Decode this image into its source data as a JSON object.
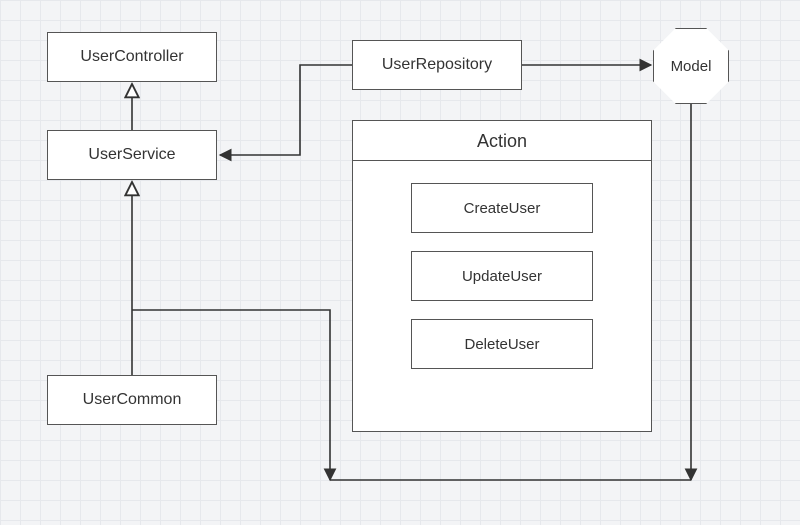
{
  "nodes": {
    "userController": "UserController",
    "userService": "UserService",
    "userCommon": "UserCommon",
    "userRepository": "UserRepository",
    "model": "Model",
    "actionTitle": "Action",
    "actions": {
      "createUser": "CreateUser",
      "updateUser": "UpdateUser",
      "deleteUser": "DeleteUser"
    }
  },
  "edges": [
    {
      "from": "UserService",
      "to": "UserController",
      "type": "open-arrow"
    },
    {
      "from": "UserCommon",
      "to": "UserService",
      "type": "open-arrow"
    },
    {
      "from": "UserRepository",
      "to": "UserService",
      "type": "filled-arrow"
    },
    {
      "from": "UserRepository",
      "to": "Model",
      "type": "filled-arrow"
    },
    {
      "from": "UserCommon",
      "to": "Action(bottom)",
      "type": "line-down"
    },
    {
      "from": "Model",
      "to": "Action(bottom)",
      "type": "line-down"
    }
  ]
}
